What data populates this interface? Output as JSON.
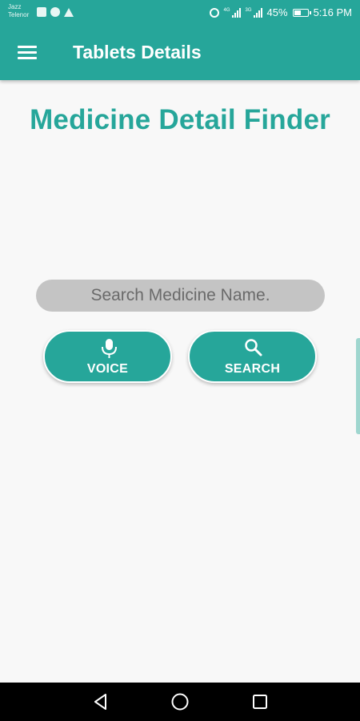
{
  "status_bar": {
    "carrier_line1": "Jazz",
    "carrier_line2": "Telenor",
    "network_left": "4G",
    "network_right": "3G",
    "battery": "45%",
    "time": "5:16 PM",
    "icons": [
      "image-icon",
      "chrome-icon",
      "drive-icon",
      "alarm-icon",
      "signal-icon",
      "signal-icon",
      "battery-icon"
    ]
  },
  "app_bar": {
    "title": "Tablets Details",
    "menu_icon": "hamburger-icon"
  },
  "main": {
    "heading": "Medicine Detail Finder",
    "search": {
      "placeholder": "Search Medicine Name.",
      "value": ""
    },
    "buttons": {
      "voice_label": "VOICE",
      "voice_icon": "microphone-icon",
      "search_label": "SEARCH",
      "search_icon": "magnifier-icon"
    }
  },
  "nav_bar": {
    "icons": [
      "back-icon",
      "home-icon",
      "recent-apps-icon"
    ]
  },
  "colors": {
    "primary": "#26a69a",
    "background": "#f8f8f8",
    "input_bg": "#c4c4c4",
    "nav_bg": "#000000"
  }
}
